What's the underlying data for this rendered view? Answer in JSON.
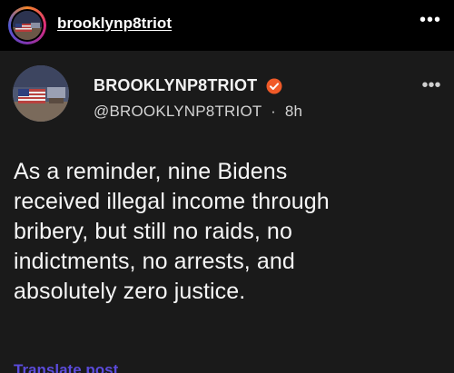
{
  "outer_header": {
    "username": "brooklynp8triot",
    "avatar_icon": "profile-avatar-icon",
    "more_icon": "more-horizontal-icon",
    "more_glyph": "•••"
  },
  "post": {
    "display_name": "BROOKLYNP8TRIOT",
    "verified_icon": "verified-badge-icon",
    "verified_color": "#f05a28",
    "handle": "@BROOKLYNP8TRIOT",
    "separator": "·",
    "timestamp": "8h",
    "more_glyph": "•••",
    "body_lines": [
      "As a reminder, nine Bidens",
      "received illegal income through",
      "bribery, but still no raids, no",
      "indictments, no arrests, and",
      "absolutely zero justice."
    ],
    "translate_label": "Translate post"
  },
  "colors": {
    "background": "#000000",
    "card": "#1a1a1a",
    "link": "#5b4bdb"
  }
}
